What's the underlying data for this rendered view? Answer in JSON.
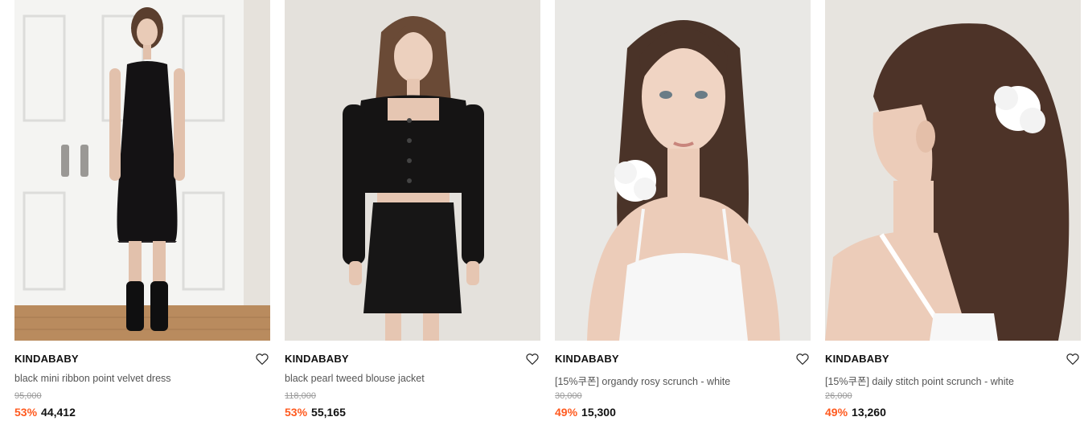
{
  "products": [
    {
      "brand": "KINDABABY",
      "name": "black mini ribbon point velvet dress",
      "original_price": "95,000",
      "discount": "53%",
      "price": "44,412",
      "image": "model-black-velvet-dress-photo"
    },
    {
      "brand": "KINDABABY",
      "name": "black pearl tweed blouse jacket",
      "original_price": "118,000",
      "discount": "53%",
      "price": "55,165",
      "image": "model-black-tweed-jacket-photo"
    },
    {
      "brand": "KINDABABY",
      "name": "[15%쿠폰] organdy rosy scrunch - white",
      "original_price": "30,000",
      "discount": "49%",
      "price": "15,300",
      "image": "model-white-scrunchie-front-photo"
    },
    {
      "brand": "KINDABABY",
      "name": "[15%쿠폰] daily stitch point scrunch - white",
      "original_price": "26,000",
      "discount": "49%",
      "price": "13,260",
      "image": "model-white-scrunchie-back-photo"
    }
  ],
  "icons": {
    "wishlist": "heart-outline-icon"
  },
  "colors": {
    "discount": "#ff5a1f",
    "brand": "#111111",
    "name": "#555555",
    "original_price": "#9a9a9a"
  }
}
